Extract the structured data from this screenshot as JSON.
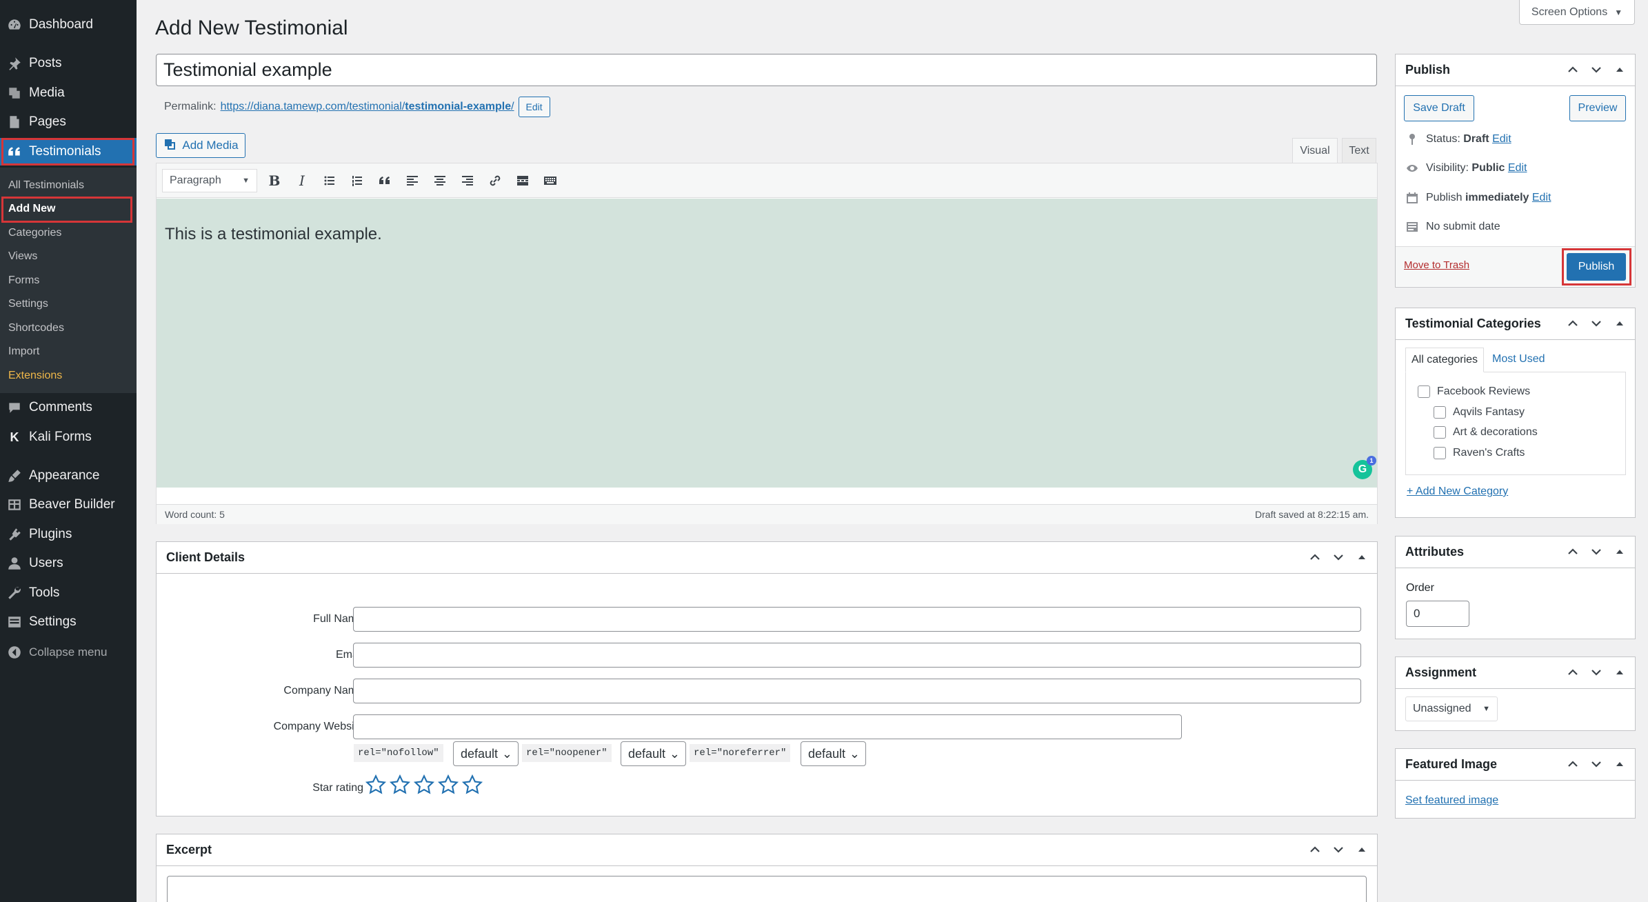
{
  "menu": {
    "items": [
      {
        "label": "Dashboard",
        "icon": "dashboard-icon"
      },
      {
        "label": "Posts",
        "icon": "pushpin-icon"
      },
      {
        "label": "Media",
        "icon": "media-icon"
      },
      {
        "label": "Pages",
        "icon": "pages-icon"
      },
      {
        "label": "Testimonials",
        "icon": "quote-icon"
      },
      {
        "label": "Comments",
        "icon": "comment-icon"
      },
      {
        "label": "Kali Forms",
        "icon": "kali-forms-icon"
      },
      {
        "label": "Appearance",
        "icon": "paintbrush-icon"
      },
      {
        "label": "Beaver Builder",
        "icon": "grid-icon"
      },
      {
        "label": "Plugins",
        "icon": "plugin-icon"
      },
      {
        "label": "Users",
        "icon": "users-icon"
      },
      {
        "label": "Tools",
        "icon": "wrench-icon"
      },
      {
        "label": "Settings",
        "icon": "settings-icon"
      }
    ],
    "submenu": [
      "All Testimonials",
      "Add New",
      "Categories",
      "Views",
      "Forms",
      "Settings",
      "Shortcodes",
      "Import",
      "Extensions"
    ],
    "collapse_label": "Collapse menu",
    "kali_letter": "K"
  },
  "header": {
    "title": "Add New Testimonial",
    "screen_options": "Screen Options"
  },
  "post": {
    "title_value": "Testimonial example",
    "permalink_label": "Permalink:",
    "permalink_base": "https://diana.tamewp.com/testimonial/",
    "permalink_slug": "testimonial-example",
    "permalink_trailing": "/",
    "edit_label": "Edit"
  },
  "editor": {
    "add_media": "Add Media",
    "tab_visual": "Visual",
    "tab_text": "Text",
    "format": "Paragraph",
    "content": "This is a testimonial example.",
    "word_count": "Word count: 5",
    "draft_saved": "Draft saved at 8:22:15 am.",
    "grammarly_letter": "G",
    "grammarly_count": "1"
  },
  "client_details": {
    "title": "Client Details",
    "full_name_label": "Full Name",
    "email_label": "Email",
    "company_name_label": "Company Name",
    "company_website_label": "Company Website",
    "rel_nofollow": "rel=\"nofollow\"",
    "rel_noopener": "rel=\"noopener\"",
    "rel_noreferrer": "rel=\"noreferrer\"",
    "rel_default": "default",
    "star_rating_label": "Star rating",
    "star_rating_value": 0,
    "star_rating_max": 5
  },
  "excerpt": {
    "title": "Excerpt"
  },
  "publish": {
    "title": "Publish",
    "save_draft": "Save Draft",
    "preview": "Preview",
    "status_label": "Status:",
    "status_value": "Draft",
    "visibility_label": "Visibility:",
    "visibility_value": "Public",
    "publish_label": "Publish",
    "publish_value": "immediately",
    "submit_date": "No submit date",
    "edit_label": "Edit",
    "move_to_trash": "Move to Trash",
    "publish_button": "Publish"
  },
  "categories": {
    "title": "Testimonial Categories",
    "tab_all": "All categories",
    "tab_used": "Most Used",
    "items": [
      "Facebook Reviews",
      "Aqvils Fantasy",
      "Art & decorations",
      "Raven's Crafts"
    ],
    "add_new": "+ Add New Category"
  },
  "attributes": {
    "title": "Attributes",
    "order_label": "Order",
    "order_value": "0"
  },
  "assignment": {
    "title": "Assignment",
    "value": "Unassigned"
  },
  "featured_image": {
    "title": "Featured Image",
    "link": "Set featured image"
  },
  "colors": {
    "menu_bg": "#1d2327",
    "accent": "#2271b1",
    "highlight": "#d63638",
    "editor_bg": "#d3e3dc"
  }
}
